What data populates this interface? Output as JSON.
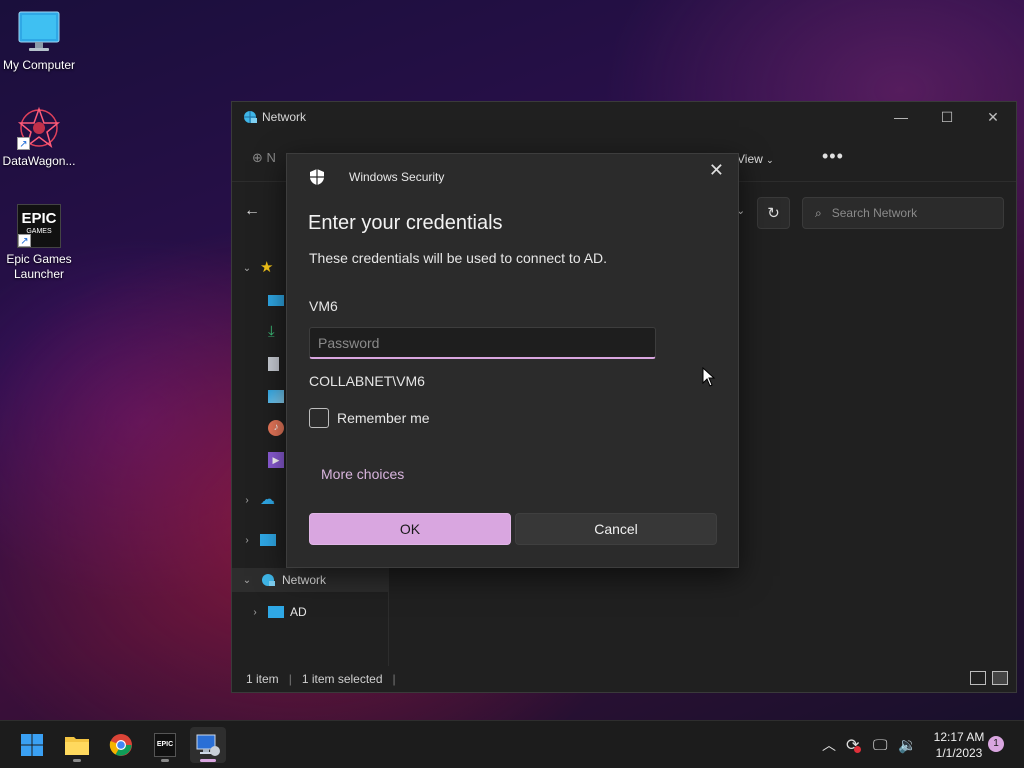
{
  "desktop": {
    "icons": [
      {
        "label": "My Computer"
      },
      {
        "label": "DataWagon..."
      },
      {
        "label": "Epic Games Launcher",
        "glyph_text": "EPIC",
        "glyph_subtext": "GAMES"
      }
    ]
  },
  "explorer": {
    "title": "Network",
    "toolbar": {
      "new_label": "N",
      "view_label": "View",
      "more_label": "•••"
    },
    "search": {
      "placeholder": "Search Network"
    },
    "sidebar": {
      "network_label": "Network",
      "ad_label": "AD"
    },
    "status": {
      "count": "1 item",
      "selected": "1 item selected"
    }
  },
  "dialog": {
    "app_name": "Windows Security",
    "title": "Enter your credentials",
    "description": "These credentials will be used to connect to AD.",
    "username": "VM6",
    "password_placeholder": "Password",
    "domain_user": "COLLABNET\\VM6",
    "remember_label": "Remember me",
    "more_choices": "More choices",
    "ok_label": "OK",
    "cancel_label": "Cancel"
  },
  "taskbar": {
    "time": "12:17 AM",
    "date": "1/1/2023",
    "notifications": "1",
    "epic_text": "EPIC"
  },
  "colors": {
    "accent": "#d9a6e0",
    "window_bg": "#202020",
    "dialog_bg": "#2b2b2b"
  }
}
